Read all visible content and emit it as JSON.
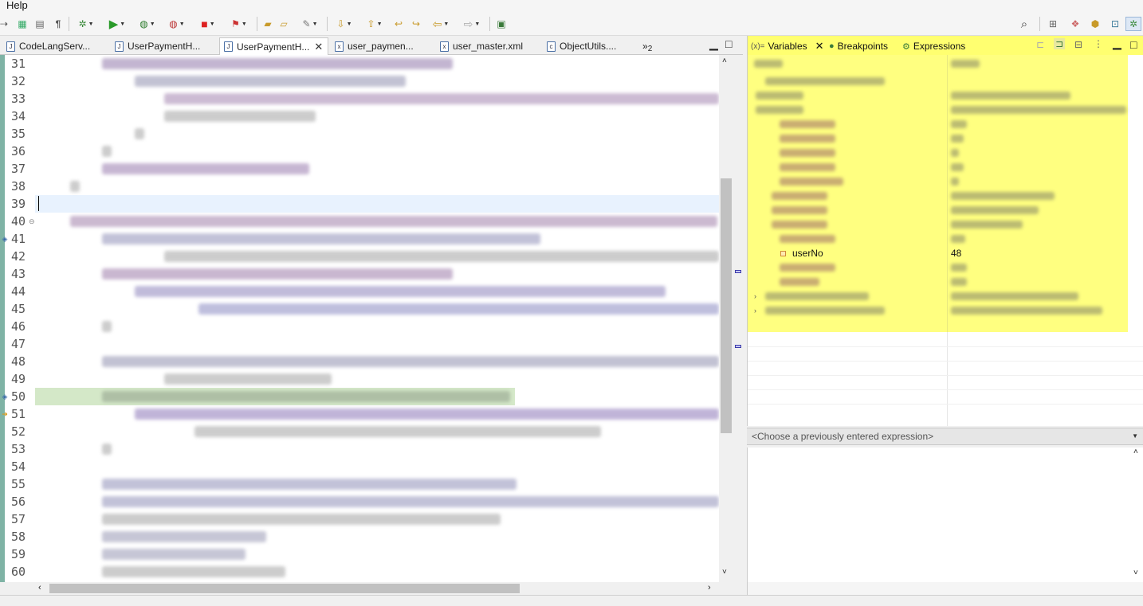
{
  "menu": {
    "help": "Help"
  },
  "colors": {
    "highlight": "#ffff80",
    "ruler": "#7fb3a5"
  },
  "editor_tabs": [
    {
      "label": "CodeLangServ...",
      "icon": "java-file-icon",
      "active": false
    },
    {
      "label": "UserPaymentH...",
      "icon": "java-file-icon",
      "active": false
    },
    {
      "label": "UserPaymentH...",
      "icon": "java-file-icon",
      "active": true
    },
    {
      "label": "user_paymen...",
      "icon": "xml-file-icon",
      "active": false
    },
    {
      "label": "user_master.xml",
      "icon": "xml-file-icon",
      "active": false
    },
    {
      "label": "ObjectUtils....",
      "icon": "class-file-icon",
      "active": false
    }
  ],
  "editor_overflow": {
    "arrows": "»",
    "count": "2"
  },
  "line_numbers": [
    "31",
    "32",
    "33",
    "34",
    "35",
    "36",
    "37",
    "38",
    "39",
    "40",
    "41",
    "42",
    "43",
    "44",
    "45",
    "46",
    "47",
    "48",
    "49",
    "50",
    "51",
    "52",
    "53",
    "54",
    "55",
    "56",
    "57",
    "58",
    "59",
    "60"
  ],
  "debug_tabs": [
    {
      "label": "Variables",
      "icon": "(x)="
    },
    {
      "label": "Breakpoints",
      "icon": "●"
    },
    {
      "label": "Expressions",
      "icon": "⚙"
    }
  ],
  "variables": {
    "selected_name": "userNo",
    "selected_value": "48"
  },
  "expression_placeholder": "<Choose a previously entered expression>"
}
